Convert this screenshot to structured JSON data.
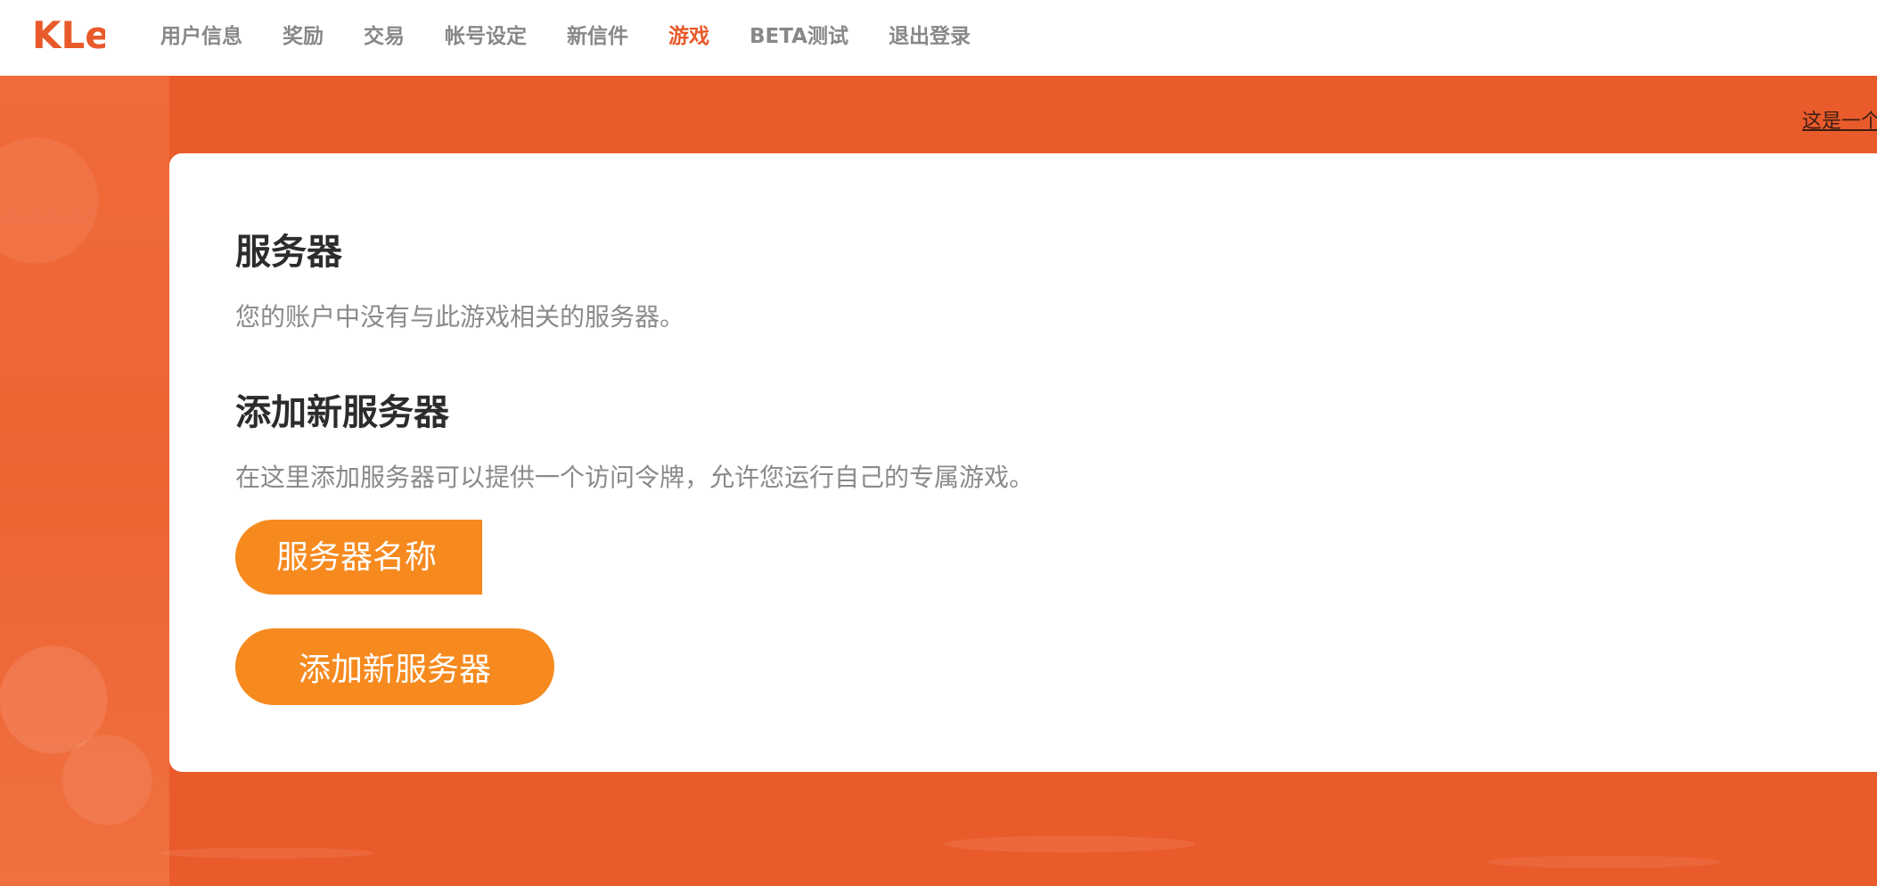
{
  "brand": {
    "logo_text": "KLei",
    "logo_color": "#e85a2a"
  },
  "nav": {
    "items": [
      {
        "label": "用户信息",
        "active": false
      },
      {
        "label": "奖励",
        "active": false
      },
      {
        "label": "交易",
        "active": false
      },
      {
        "label": "帐号设定",
        "active": false
      },
      {
        "label": "新信件",
        "active": false
      },
      {
        "label": "游戏",
        "active": true
      },
      {
        "label": "BETA测试",
        "active": false
      },
      {
        "label": "退出登录",
        "active": false
      }
    ]
  },
  "hero": {
    "notice_link": "这是一个"
  },
  "servers": {
    "title": "服务器",
    "empty_message": "您的账户中没有与此游戏相关的服务器。"
  },
  "add_server": {
    "title": "添加新服务器",
    "description": "在这里添加服务器可以提供一个访问令牌，允许您运行自己的专属游戏。",
    "name_placeholder": "服务器名称",
    "name_value": "",
    "submit_label": "添加新服务器"
  },
  "colors": {
    "accent": "#e85a2a",
    "button": "#f68a1f",
    "heading": "#2c2c2c",
    "muted": "#8a8a8a"
  }
}
